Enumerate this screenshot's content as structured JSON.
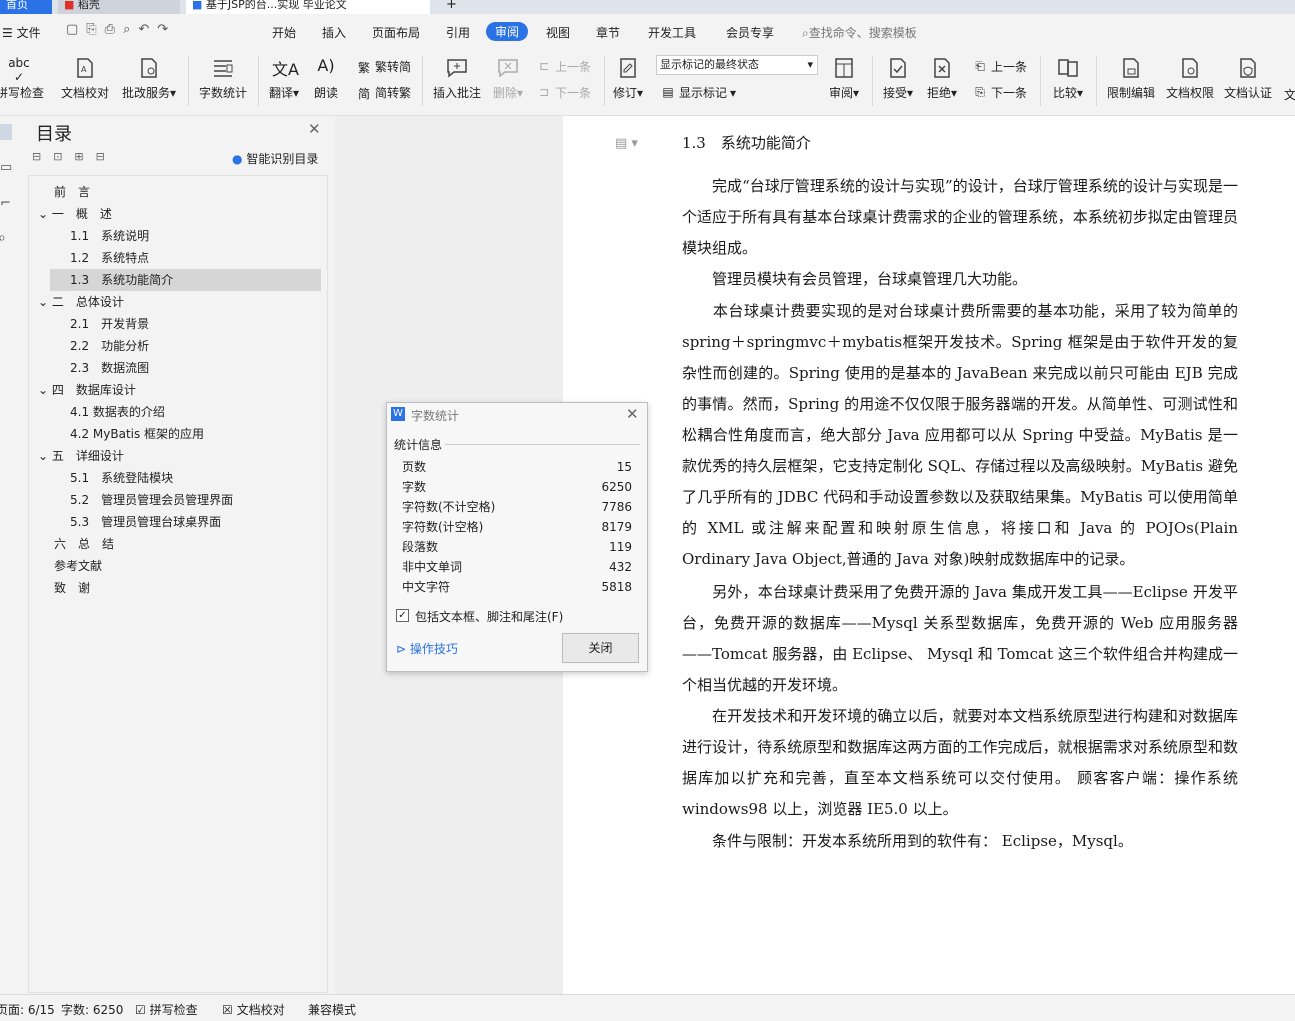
{
  "tabs": [
    "首页",
    "稻壳",
    "基于JSP的台...实现 毕业论文"
  ],
  "menu": {
    "file": "文件",
    "items": [
      "开始",
      "插入",
      "页面布局",
      "引用",
      "审阅",
      "视图",
      "章节",
      "开发工具",
      "会员专享"
    ],
    "active": "审阅",
    "search": "查找命令、搜索模板"
  },
  "ribbon": {
    "spell": "拼写检查",
    "proof": "文档校对",
    "review_service": "批改服务",
    "word_count": "字数统计",
    "translate": "翻译",
    "read": "朗读",
    "trad": "繁转简",
    "simp": "简转繁",
    "insert_comment": "插入批注",
    "delete": "删除",
    "prev_comment": "上一条",
    "next_comment": "下一条",
    "revise": "修订",
    "display_select": "显示标记的最终状态",
    "show_markup": "显示标记",
    "review": "审阅",
    "accept": "接受",
    "reject": "拒绝",
    "prev": "上一条",
    "next": "下一条",
    "compare": "比较",
    "restrict": "限制编辑",
    "permission": "文档权限",
    "cert": "文档认证",
    "more": "文"
  },
  "toc": {
    "title": "目录",
    "smart": "智能识别目录",
    "items": [
      "前　言",
      "一　概　述",
      "1.1　系统说明",
      "1.2　系统特点",
      "1.3　系统功能简介",
      "二　总体设计",
      "2.1　开发背景",
      "2.2　功能分析",
      "2.3　数据流图",
      "四　数据库设计",
      "4.1 数据表的介绍",
      "4.2 MyBatis 框架的应用",
      "五　详细设计",
      "5.1　系统登陆模块",
      "5.2　管理员管理会员管理界面",
      "5.3　管理员管理台球桌界面",
      "六　总　结",
      "参考文献",
      "致　谢"
    ]
  },
  "document": {
    "heading": "1.3　系统功能简介",
    "p1": "　　完成“台球厅管理系统的设计与实现”的设计，台球厅管理系统的设计与实现是一个适应于所有具有基本台球桌计费需求的企业的管理系统，本系统初步拟定由管理员模块组成。",
    "p2": "　　管理员模块有会员管理，台球桌管理几大功能。",
    "p3": "　　本台球桌计费要实现的是对台球桌计费所需要的基本功能，采用了较为简单的 spring＋springmvc＋mybatis框架开发技术。Spring 框架是由于软件开发的复杂性而创建的。Spring 使用的是基本的 JavaBean 来完成以前只可能由 EJB 完成的事情。然而，Spring 的用途不仅仅限于服务器端的开发。从简单性、可测试性和松耦合性角度而言，绝大部分 Java 应用都可以从 Spring 中受益。MyBatis 是一款优秀的持久层框架，它支持定制化 SQL、存储过程以及高级映射。MyBatis 避免了几乎所有的 JDBC 代码和手动设置参数以及获取结果集。MyBatis 可以使用简单的 XML 或注解来配置和映射原生信息，将接口和 Java 的 POJOs(Plain Ordinary Java Object,普通的 Java 对象)映射成数据库中的记录。",
    "p4": "　　另外，本台球桌计费采用了免费开源的 Java 集成开发工具——Eclipse 开发平台，免费开源的数据库——Mysql 关系型数据库，免费开源的 Web 应用服务器——Tomcat 服务器，由 Eclipse、 Mysql 和 Tomcat 这三个软件组合并构建成一个相当优越的开发环境。",
    "p5": "　　在开发技术和开发环境的确立以后，就要对本文档系统原型进行构建和对数据库进行设计，待系统原型和数据库这两方面的工作完成后，就根据需求对系统原型和数据库加以扩充和完善，直至本文档系统可以交付使用。 顾客客户端：操作系统 windows98 以上，浏览器 IE5.0 以上。",
    "p6": "　　条件与限制：开发本系统所用到的软件有： Eclipse，Mysql。"
  },
  "dialog": {
    "title": "字数统计",
    "section": "统计信息",
    "rows": [
      {
        "k": "页数",
        "v": "15"
      },
      {
        "k": "字数",
        "v": "6250"
      },
      {
        "k": "字符数(不计空格)",
        "v": "7786"
      },
      {
        "k": "字符数(计空格)",
        "v": "8179"
      },
      {
        "k": "段落数",
        "v": "119"
      },
      {
        "k": "非中文单词",
        "v": "432"
      },
      {
        "k": "中文字符",
        "v": "5818"
      }
    ],
    "checkbox": "包括文本框、脚注和尾注(F)",
    "tips": "操作技巧",
    "close": "关闭"
  },
  "status": {
    "page": "页面: 6/15",
    "words": "字数: 6250",
    "spell": "拼写检查",
    "proof": "文档校对",
    "compat": "兼容模式"
  }
}
